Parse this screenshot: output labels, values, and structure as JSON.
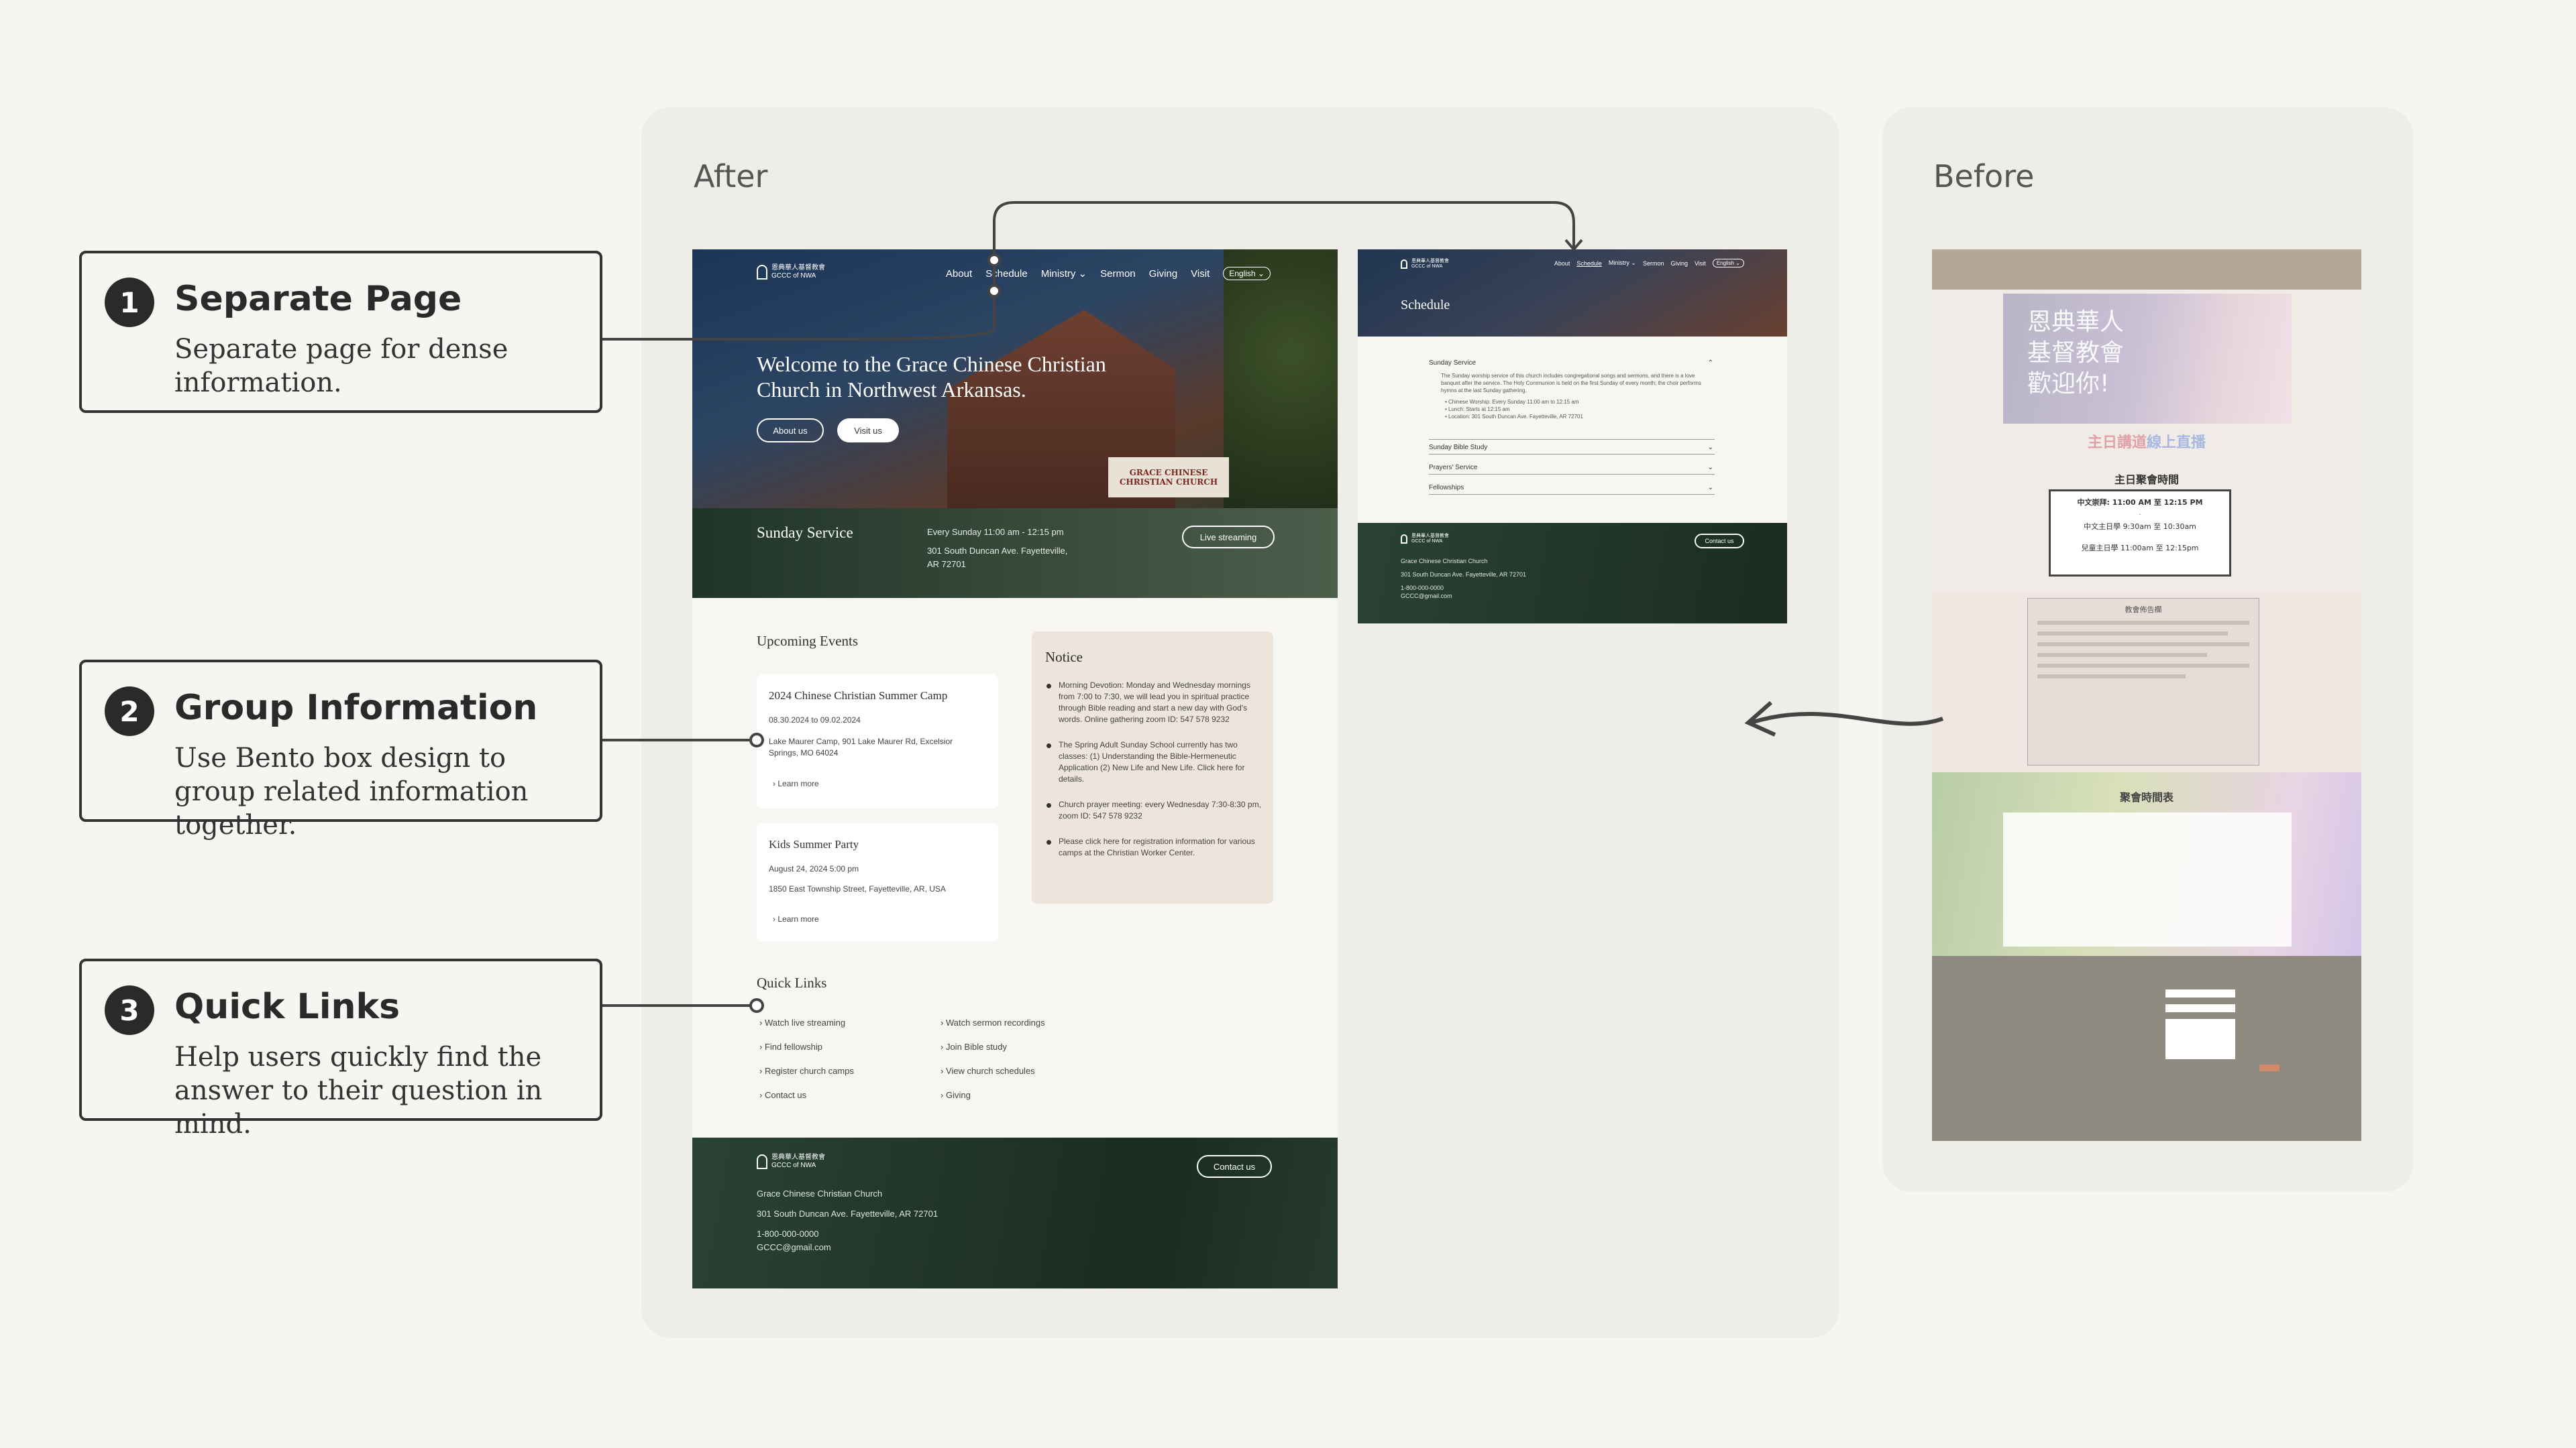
{
  "callouts": [
    {
      "num": "1",
      "title": "Separate Page",
      "desc": "Separate page for dense information."
    },
    {
      "num": "2",
      "title": "Group Information",
      "desc": "Use Bento box design to group related information together."
    },
    {
      "num": "3",
      "title": "Quick Links",
      "desc": "Help users quickly find the answer to their question in mind."
    }
  ],
  "panels": {
    "after": "After",
    "before": "Before"
  },
  "site": {
    "logo_cn": "恩典華人基督教會",
    "logo_en": "GCCC of NWA",
    "nav": [
      "About",
      "Schedule",
      "Ministry",
      "Sermon",
      "Giving",
      "Visit"
    ],
    "lang": "English",
    "hero_title": "Welcome to the Grace Chinese Christian Church in Northwest Arkansas.",
    "btn_about": "About us",
    "btn_visit": "Visit us",
    "sign": "GRACE CHINESE CHRISTIAN CHURCH",
    "sunday_title": "Sunday Service",
    "sunday_time": "Every Sunday 11:00 am - 12:15 pm",
    "sunday_addr": "301 South Duncan Ave. Fayetteville, AR 72701",
    "live_btn": "Live streaming",
    "events_title": "Upcoming Events",
    "events": [
      {
        "title": "2024 Chinese Christian Summer Camp",
        "date": "08.30.2024 to 09.02.2024",
        "place": "Lake Maurer Camp, 901 Lake Maurer Rd, Excelsior Springs, MO 64024",
        "more": "Learn more"
      },
      {
        "title": "Kids Summer Party",
        "date": "August 24, 2024 5:00 pm",
        "place": "1850 East Township Street, Fayetteville, AR, USA",
        "more": "Learn more"
      }
    ],
    "notice_title": "Notice",
    "notices": [
      "Morning Devotion: Monday and Wednesday mornings from 7:00 to 7:30, we will lead you in spiritual practice through Bible reading and start a new day with God's words. Online gathering zoom ID: 547 578 9232",
      "The Spring Adult Sunday School currently has two classes: (1) Understanding the Bible-Hermeneutic Application (2) New Life and New Life. Click here for details.",
      "Church prayer meeting: every Wednesday 7:30-8:30 pm, zoom ID: 547 578 9232",
      "Please click here for registration information for various camps at the Christian Worker Center."
    ],
    "quick_title": "Quick Links",
    "quick_left": [
      "Watch live streaming",
      "Find fellowship",
      "Register church camps",
      "Contact us"
    ],
    "quick_right": [
      "Watch sermon recordings",
      "Join Bible study",
      "View church schedules",
      "Giving"
    ],
    "footer_name": "Grace Chinese Christian Church",
    "footer_addr": "301 South Duncan Ave. Fayetteville, AR 72701",
    "footer_phone": "1-800-000-0000",
    "footer_email": "GCCC@gmail.com",
    "contact_btn": "Contact us"
  },
  "schedule": {
    "title": "Schedule",
    "items": [
      "Sunday Service",
      "Sunday Bible Study",
      "Prayers' Service",
      "Fellowships"
    ],
    "service_desc": "The Sunday worship service of this church includes congregational songs and sermons, and there is a love banquet after the service. The Holy Communion is held on the first Sunday of every month; the choir performs hymns at the last Sunday gathering.",
    "bullets": [
      "Chinese Worship: Every Sunday 11:00 am to 12:15 am",
      "Lunch: Starts at 12:15 am",
      "Location: 301 South Duncan Ave. Fayetteville, AR 72701"
    ]
  },
  "before": {
    "hero_text": "恩典華人\n基督教會\n歡迎你!",
    "live": "主日講道",
    "live2": "線上直播",
    "service_head": "主日聚會時間",
    "service_lines": [
      "中文崇拜: 11:00 AM 至 12:15 PM",
      "中文主日學 9:30am 至 10:30am",
      "兒童主日學 11:00am 至 12:15pm"
    ],
    "notice_head": "教會佈告欄",
    "table_head": "聚會時間表"
  },
  "colors": {
    "dark_green": "#1f3529",
    "note_bg": "#ede5dc",
    "page_bg": "#f6f5f1"
  }
}
